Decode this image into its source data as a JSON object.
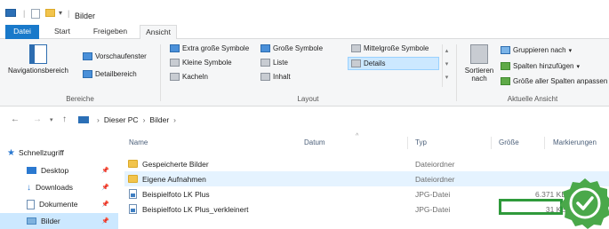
{
  "window": {
    "title": "Bilder"
  },
  "ribbon_tabs": [
    "Datei",
    "Start",
    "Freigeben",
    "Ansicht"
  ],
  "ribbon": {
    "panes": {
      "navigationsbereich": "Navigationsbereich",
      "vorschaufenster": "Vorschaufenster",
      "detailbereich": "Detailbereich",
      "group_label": "Bereiche"
    },
    "layout": {
      "extra_large": "Extra große Symbole",
      "large": "Große Symbole",
      "medium": "Mittelgroße Symbole",
      "small": "Kleine Symbole",
      "list": "Liste",
      "details": "Details",
      "tiles": "Kacheln",
      "content": "Inhalt",
      "group_label": "Layout"
    },
    "current_view": {
      "sort_by": "Sortieren nach",
      "group_by": "Gruppieren nach",
      "add_columns": "Spalten hinzufügen",
      "size_all": "Größe aller Spalten anpassen",
      "group_label": "Aktuelle Ansicht"
    }
  },
  "address": {
    "crumbs": [
      "Dieser PC",
      "Bilder"
    ]
  },
  "sidebar": {
    "items": [
      {
        "label": "Schnellzugriff"
      },
      {
        "label": "Desktop"
      },
      {
        "label": "Downloads"
      },
      {
        "label": "Dokumente"
      },
      {
        "label": "Bilder"
      }
    ]
  },
  "columns": {
    "name": "Name",
    "date": "Datum",
    "type": "Typ",
    "size": "Größe",
    "tags": "Markierungen"
  },
  "files": [
    {
      "name": "Gespeicherte Bilder",
      "type": "Dateiordner",
      "size": ""
    },
    {
      "name": "Eigene Aufnahmen",
      "type": "Dateiordner",
      "size": ""
    },
    {
      "name": "Beispielfoto LK Plus",
      "type": "JPG-Datei",
      "size": "6.371 KB"
    },
    {
      "name": "Beispielfoto LK Plus_verkleinert",
      "type": "JPG-Datei",
      "size": "31 KB"
    }
  ],
  "colors": {
    "accent": "#1979ca",
    "highlight": "#2f9a3b",
    "selection": "#cce8ff"
  }
}
